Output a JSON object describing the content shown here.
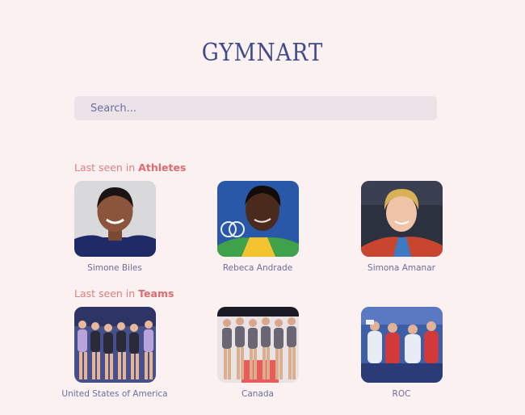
{
  "header": {
    "logo": "GYMNART"
  },
  "search": {
    "placeholder": "Search..."
  },
  "sections": {
    "athletes": {
      "prefix": "Last seen in ",
      "name": "Athletes",
      "items": [
        {
          "label": "Simone Biles"
        },
        {
          "label": "Rebeca Andrade"
        },
        {
          "label": "Simona Amanar"
        }
      ]
    },
    "teams": {
      "prefix": "Last seen in ",
      "name": "Teams",
      "items": [
        {
          "label": "United States of America"
        },
        {
          "label": "Canada"
        },
        {
          "label": "ROC"
        }
      ]
    }
  },
  "colors": {
    "background": "#fbf1f0",
    "logo": "#3f4b8e",
    "accent": "#e06a6e",
    "caption": "#6d6e9c",
    "search_bg": "#ebe3e8"
  }
}
